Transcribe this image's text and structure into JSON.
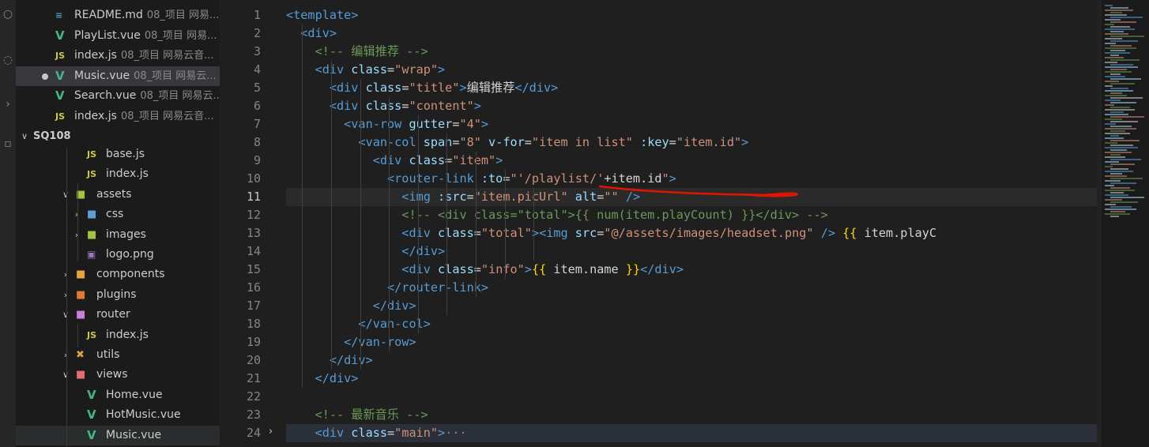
{
  "sidebar": {
    "open_editors": [
      {
        "icon": "md",
        "name": "README.md",
        "desc": "08_项目 网易..."
      },
      {
        "icon": "vue",
        "name": "PlayList.vue",
        "desc": "08_项目 网易..."
      },
      {
        "icon": "js",
        "name": "index.js",
        "desc": "08_项目 网易云音..."
      },
      {
        "icon": "vue",
        "name": "Music.vue",
        "desc": "08_项目 网易云...",
        "modified": true
      },
      {
        "icon": "vue",
        "name": "Search.vue",
        "desc": "08_项目 网易云..."
      },
      {
        "icon": "js",
        "name": "index.js",
        "desc": "08_项目 网易云音..."
      }
    ],
    "section_title": "SQ108",
    "tree": [
      {
        "icon": "js",
        "name": "base.js",
        "depth": 2
      },
      {
        "icon": "js",
        "name": "index.js",
        "depth": 2
      },
      {
        "icon": "fold-img",
        "name": "assets",
        "depth": 1,
        "expanded": true
      },
      {
        "icon": "foldb",
        "name": "css",
        "depth": 2,
        "expanded": false
      },
      {
        "icon": "fold-img",
        "name": "images",
        "depth": 2,
        "expanded": false
      },
      {
        "icon": "png",
        "name": "logo.png",
        "depth": 2
      },
      {
        "icon": "fold",
        "name": "components",
        "depth": 1,
        "expanded": false
      },
      {
        "icon": "fold-pl",
        "name": "plugins",
        "depth": 1,
        "expanded": false
      },
      {
        "icon": "fold-rt",
        "name": "router",
        "depth": 1,
        "expanded": true
      },
      {
        "icon": "js",
        "name": "index.js",
        "depth": 2
      },
      {
        "icon": "fold-ut",
        "name": "utils",
        "depth": 1,
        "expanded": false
      },
      {
        "icon": "fold-vw",
        "name": "views",
        "depth": 1,
        "expanded": true
      },
      {
        "icon": "vue",
        "name": "Home.vue",
        "depth": 2
      },
      {
        "icon": "vue",
        "name": "HotMusic.vue",
        "depth": 2
      },
      {
        "icon": "vue",
        "name": "Music.vue",
        "depth": 2,
        "active": true
      }
    ],
    "icon_glyphs": {
      "vue": "V",
      "js": "JS",
      "md": "≡",
      "png": "▣",
      "fold": "■",
      "foldb": "■",
      "fold-img": "■",
      "fold-pl": "■",
      "fold-rt": "■",
      "fold-ut": "✖",
      "fold-vw": "■"
    }
  },
  "editor": {
    "line_numbers": [
      "1",
      "2",
      "3",
      "4",
      "5",
      "6",
      "7",
      "8",
      "9",
      "10",
      "11",
      "12",
      "13",
      "14",
      "15",
      "16",
      "17",
      "18",
      "19",
      "20",
      "21",
      "22",
      "23",
      "24"
    ],
    "current_line": 11,
    "lines": [
      [
        [
          "tag",
          "<template>"
        ]
      ],
      [
        [
          "tag",
          "  <div>"
        ]
      ],
      [
        [
          "cm",
          "    <!-- 编辑推荐 -->"
        ]
      ],
      [
        [
          "tag",
          "    <div "
        ],
        [
          "attr",
          "class"
        ],
        [
          "txt",
          "="
        ],
        [
          "str",
          "\"wrap\""
        ],
        [
          "tag",
          ">"
        ]
      ],
      [
        [
          "tag",
          "      <div "
        ],
        [
          "attr",
          "class"
        ],
        [
          "txt",
          "="
        ],
        [
          "str",
          "\"title\""
        ],
        [
          "tag",
          ">"
        ],
        [
          "txt",
          "编辑推荐"
        ],
        [
          "tag",
          "</div>"
        ]
      ],
      [
        [
          "tag",
          "      <div "
        ],
        [
          "attr",
          "class"
        ],
        [
          "txt",
          "="
        ],
        [
          "str",
          "\"content\""
        ],
        [
          "tag",
          ">"
        ]
      ],
      [
        [
          "tag",
          "        <van-row "
        ],
        [
          "attr",
          "gutter"
        ],
        [
          "txt",
          "="
        ],
        [
          "str",
          "\"4\""
        ],
        [
          "tag",
          ">"
        ]
      ],
      [
        [
          "tag",
          "          <van-col "
        ],
        [
          "attr",
          "span"
        ],
        [
          "txt",
          "="
        ],
        [
          "str",
          "\"8\" "
        ],
        [
          "attr",
          "v-for"
        ],
        [
          "txt",
          "="
        ],
        [
          "str",
          "\"item in list\" "
        ],
        [
          "attr",
          ":key"
        ],
        [
          "txt",
          "="
        ],
        [
          "str",
          "\"item.id\""
        ],
        [
          "tag",
          ">"
        ]
      ],
      [
        [
          "tag",
          "            <div "
        ],
        [
          "attr",
          "class"
        ],
        [
          "txt",
          "="
        ],
        [
          "str",
          "\"item\""
        ],
        [
          "tag",
          ">"
        ]
      ],
      [
        [
          "tag",
          "              <router-link "
        ],
        [
          "attr",
          ":to"
        ],
        [
          "txt",
          "="
        ],
        [
          "str",
          "\"'/playlist/'"
        ],
        [
          "txt",
          "+item.id"
        ],
        [
          "str",
          "\""
        ],
        [
          "tag",
          ">"
        ]
      ],
      [
        [
          "tag",
          "                <img "
        ],
        [
          "attr",
          ":src"
        ],
        [
          "txt",
          "="
        ],
        [
          "str",
          "\"item.picUrl\" "
        ],
        [
          "attr",
          "alt"
        ],
        [
          "txt",
          "="
        ],
        [
          "str",
          "\"\" "
        ],
        [
          "tag",
          "/>"
        ]
      ],
      [
        [
          "cm",
          "                <!-- <div class=\"total\">{{ num(item.playCount) }}</div> -->"
        ]
      ],
      [
        [
          "tag",
          "                <div "
        ],
        [
          "attr",
          "class"
        ],
        [
          "txt",
          "="
        ],
        [
          "str",
          "\"total\""
        ],
        [
          "tag",
          "><img "
        ],
        [
          "attr",
          "src"
        ],
        [
          "txt",
          "="
        ],
        [
          "str",
          "\"@/assets/images/headset.png\" "
        ],
        [
          "tag",
          "/> "
        ],
        [
          "mus",
          "{{"
        ],
        [
          "txt",
          " item.playC"
        ]
      ],
      [
        [
          "tag",
          "                </div>"
        ]
      ],
      [
        [
          "tag",
          "                <div "
        ],
        [
          "attr",
          "class"
        ],
        [
          "txt",
          "="
        ],
        [
          "str",
          "\"info\""
        ],
        [
          "tag",
          ">"
        ],
        [
          "mus",
          "{{"
        ],
        [
          "txt",
          " item.name "
        ],
        [
          "mus",
          "}}"
        ],
        [
          "tag",
          "</div>"
        ]
      ],
      [
        [
          "tag",
          "              </router-link>"
        ]
      ],
      [
        [
          "tag",
          "            </div>"
        ]
      ],
      [
        [
          "tag",
          "          </van-col>"
        ]
      ],
      [
        [
          "tag",
          "        </van-row>"
        ]
      ],
      [
        [
          "tag",
          "      </div>"
        ]
      ],
      [
        [
          "tag",
          "    </div>"
        ]
      ],
      [
        [
          "txt",
          ""
        ]
      ],
      [
        [
          "cm",
          "    <!-- 最新音乐 -->"
        ]
      ],
      [
        [
          "tag",
          "    <div "
        ],
        [
          "attr",
          "class"
        ],
        [
          "txt",
          "="
        ],
        [
          "str",
          "\"main\""
        ],
        [
          "tag",
          ">"
        ],
        [
          "br",
          "···"
        ]
      ]
    ],
    "colors": {
      "keyword": "#569cd6",
      "attribute": "#9cdcfe",
      "string": "#ce9178",
      "comment": "#6a9955",
      "annotation": "#e51400"
    }
  }
}
